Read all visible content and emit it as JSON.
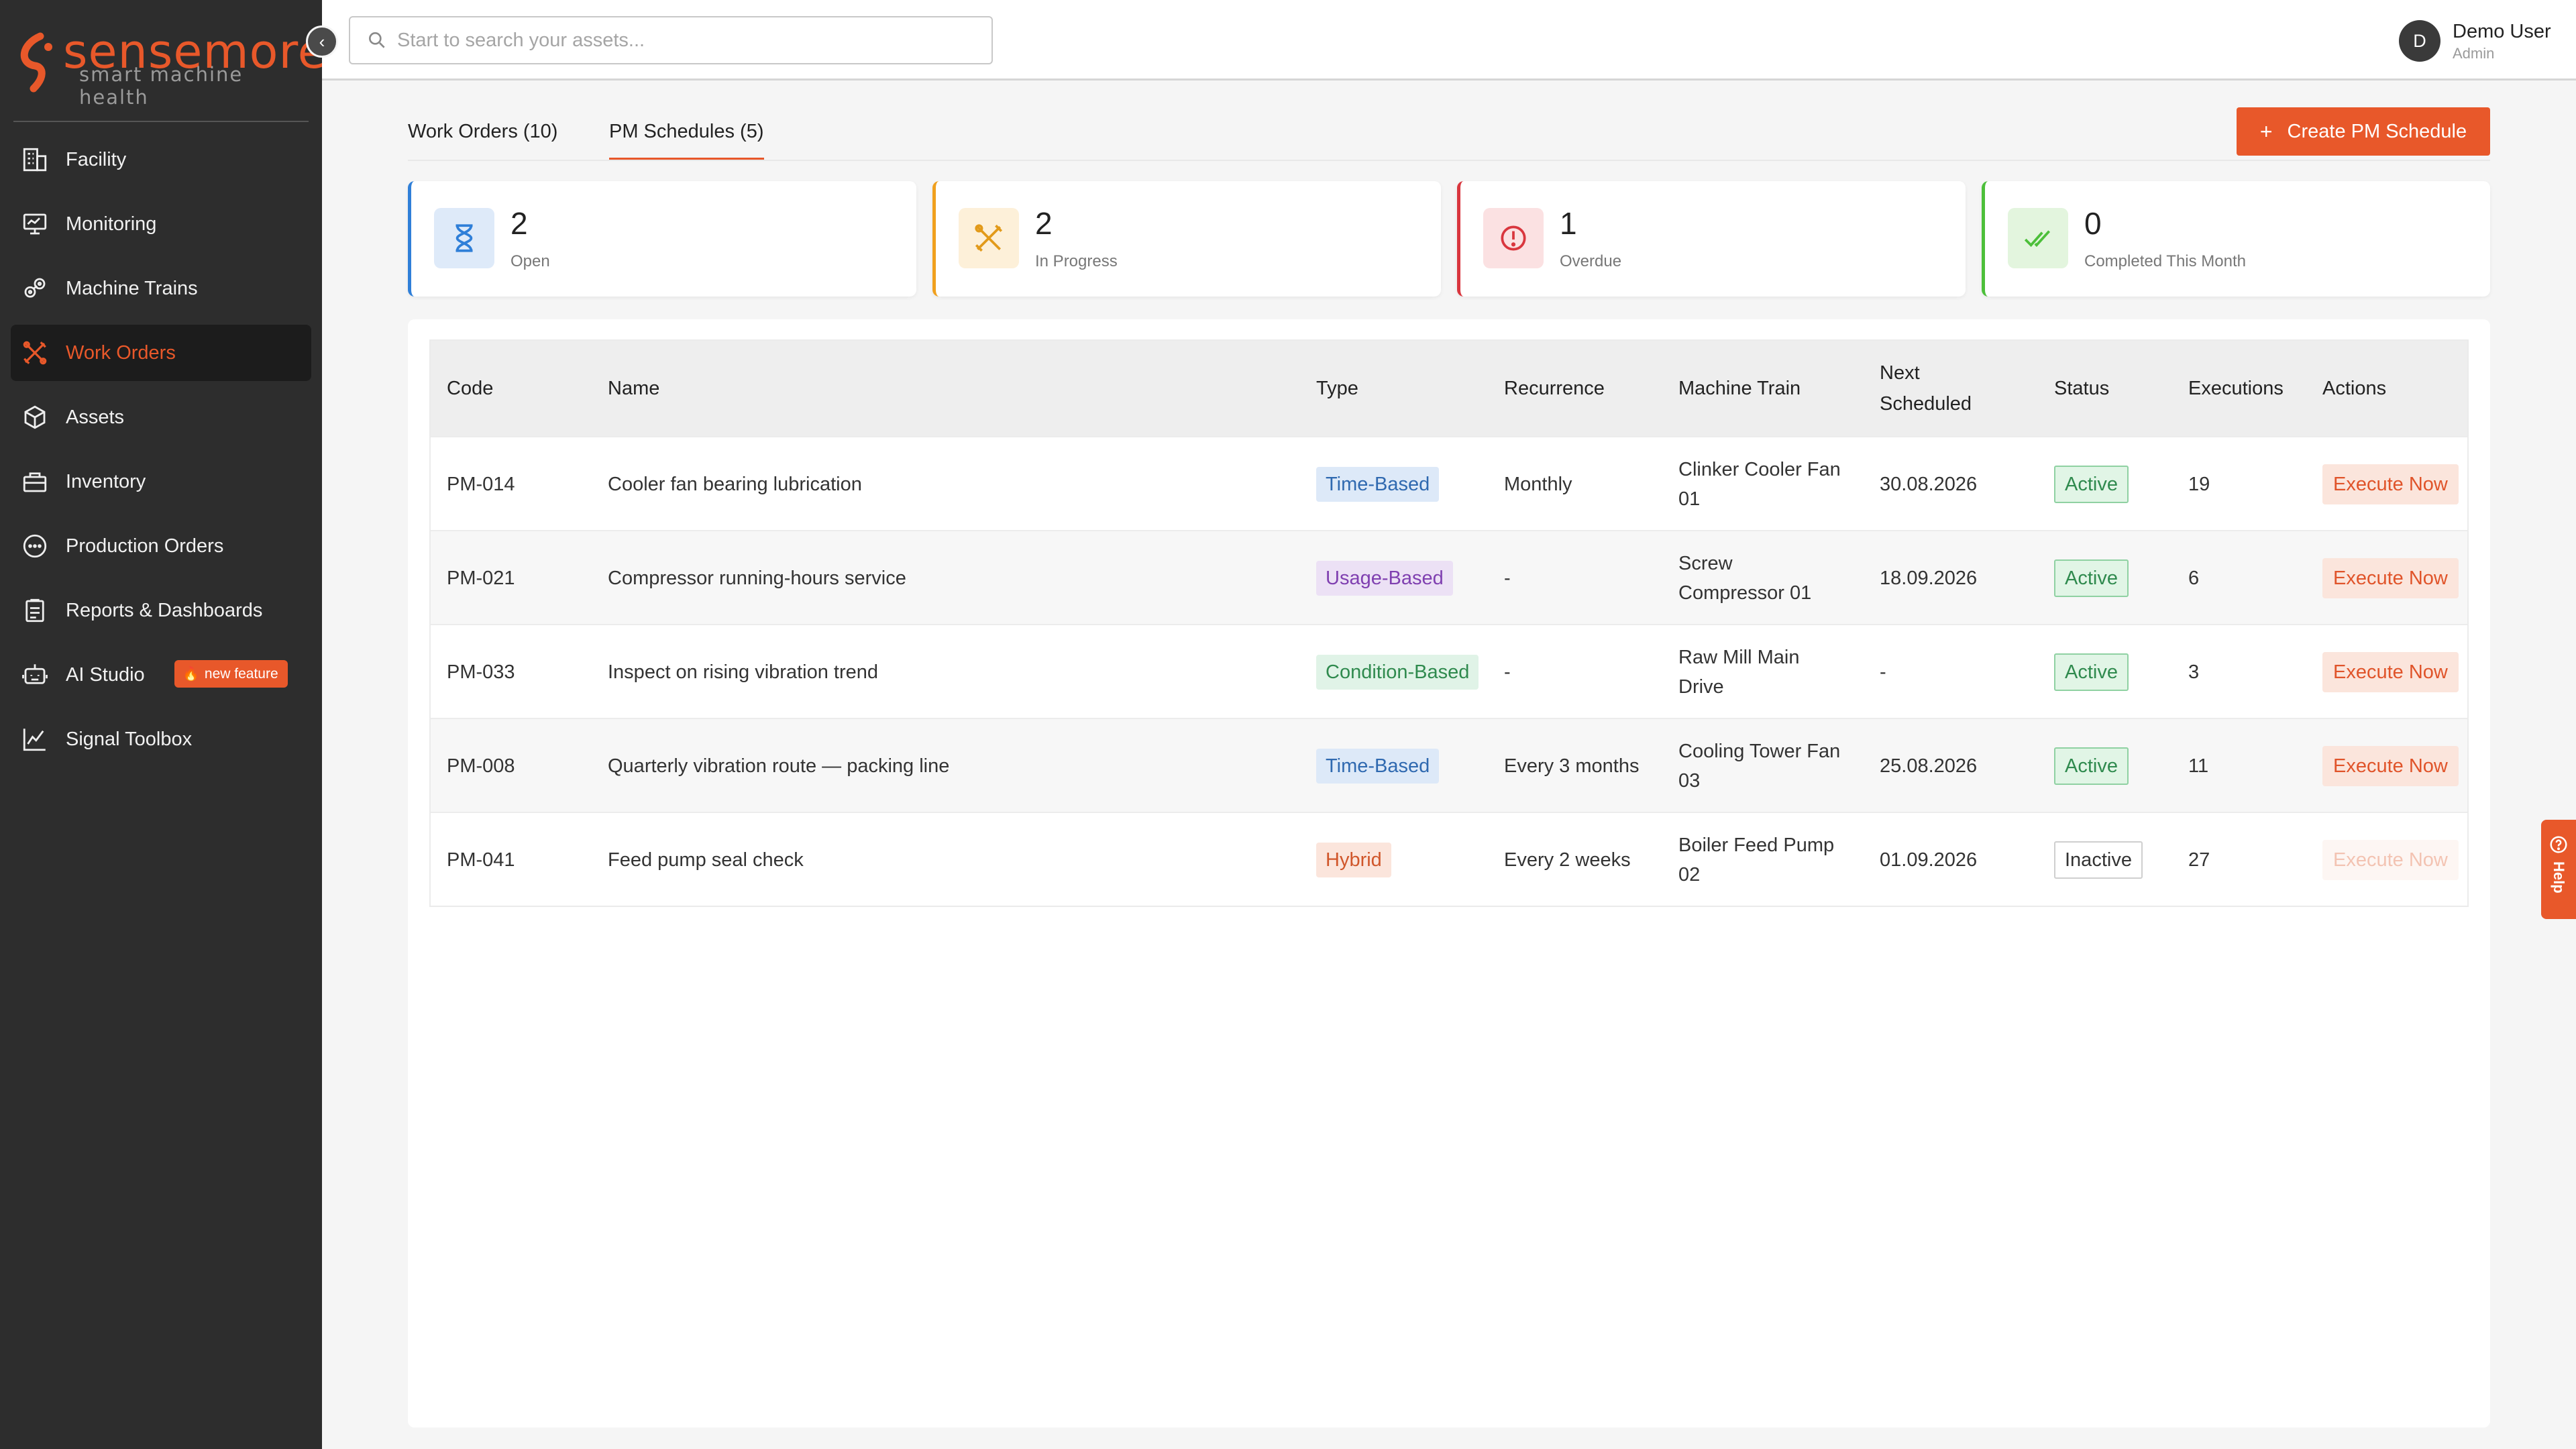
{
  "brand": {
    "name": "sensemore",
    "tagline": "smart machine health",
    "accent": "#e8582a"
  },
  "sidebar": {
    "items": [
      {
        "label": "Facility",
        "icon": "building-icon"
      },
      {
        "label": "Monitoring",
        "icon": "monitor-icon"
      },
      {
        "label": "Machine Trains",
        "icon": "machine-train-icon"
      },
      {
        "label": "Work Orders",
        "icon": "tools-icon",
        "active": true
      },
      {
        "label": "Assets",
        "icon": "cube-icon"
      },
      {
        "label": "Inventory",
        "icon": "briefcase-icon"
      },
      {
        "label": "Production Orders",
        "icon": "dots-circle-icon"
      },
      {
        "label": "Reports & Dashboards",
        "icon": "clipboard-icon"
      },
      {
        "label": "AI Studio",
        "icon": "robot-icon",
        "badge": "new feature"
      },
      {
        "label": "Signal Toolbox",
        "icon": "line-chart-icon"
      }
    ]
  },
  "search": {
    "placeholder": "Start to search your assets...",
    "value": ""
  },
  "user": {
    "initial": "D",
    "name": "Demo User",
    "role": "Admin"
  },
  "tabs": [
    {
      "label": "Work Orders (10)",
      "active": false
    },
    {
      "label": "PM Schedules (5)",
      "active": true
    }
  ],
  "create_button": {
    "label": "Create PM Schedule"
  },
  "stats": [
    {
      "value": "2",
      "label": "Open",
      "color": "#2f7fd8",
      "icon": "hourglass-icon"
    },
    {
      "value": "2",
      "label": "In Progress",
      "color": "#f0a01e",
      "icon": "tools-icon"
    },
    {
      "value": "1",
      "label": "Overdue",
      "color": "#d9363e",
      "icon": "alert-circle-icon"
    },
    {
      "value": "0",
      "label": "Completed This Month",
      "color": "#4cbf3a",
      "icon": "double-check-icon"
    }
  ],
  "table": {
    "columns": [
      "Code",
      "Name",
      "Type",
      "Recurrence",
      "Machine Train",
      "Next Scheduled",
      "Status",
      "Executions",
      "Actions"
    ],
    "rows": [
      {
        "code": "PM-014",
        "name": "Cooler fan bearing lubrication",
        "type": "Time-Based",
        "type_kind": "time",
        "recurrence": "Monthly",
        "machine_train": "Clinker Cooler Fan 01",
        "next": "30.08.2026",
        "status": "Active",
        "executions": "19",
        "action": "Execute Now",
        "action_enabled": true
      },
      {
        "code": "PM-021",
        "name": "Compressor running-hours service",
        "type": "Usage-Based",
        "type_kind": "usage",
        "recurrence": "-",
        "machine_train": "Screw Compressor 01",
        "next": "18.09.2026",
        "status": "Active",
        "executions": "6",
        "action": "Execute Now",
        "action_enabled": true
      },
      {
        "code": "PM-033",
        "name": "Inspect on rising vibration trend",
        "type": "Condition-Based",
        "type_kind": "cond",
        "recurrence": "-",
        "machine_train": "Raw Mill Main Drive",
        "next": "-",
        "status": "Active",
        "executions": "3",
        "action": "Execute Now",
        "action_enabled": true
      },
      {
        "code": "PM-008",
        "name": "Quarterly vibration route — packing line",
        "type": "Time-Based",
        "type_kind": "time",
        "recurrence": "Every 3 months",
        "machine_train": "Cooling Tower Fan 03",
        "next": "25.08.2026",
        "status": "Active",
        "executions": "11",
        "action": "Execute Now",
        "action_enabled": true
      },
      {
        "code": "PM-041",
        "name": "Feed pump seal check",
        "type": "Hybrid",
        "type_kind": "hybrid",
        "recurrence": "Every 2 weeks",
        "machine_train": "Boiler Feed Pump 02",
        "next": "01.09.2026",
        "status": "Inactive",
        "executions": "27",
        "action": "Execute Now",
        "action_enabled": false
      }
    ]
  },
  "help": {
    "label": "Help"
  }
}
